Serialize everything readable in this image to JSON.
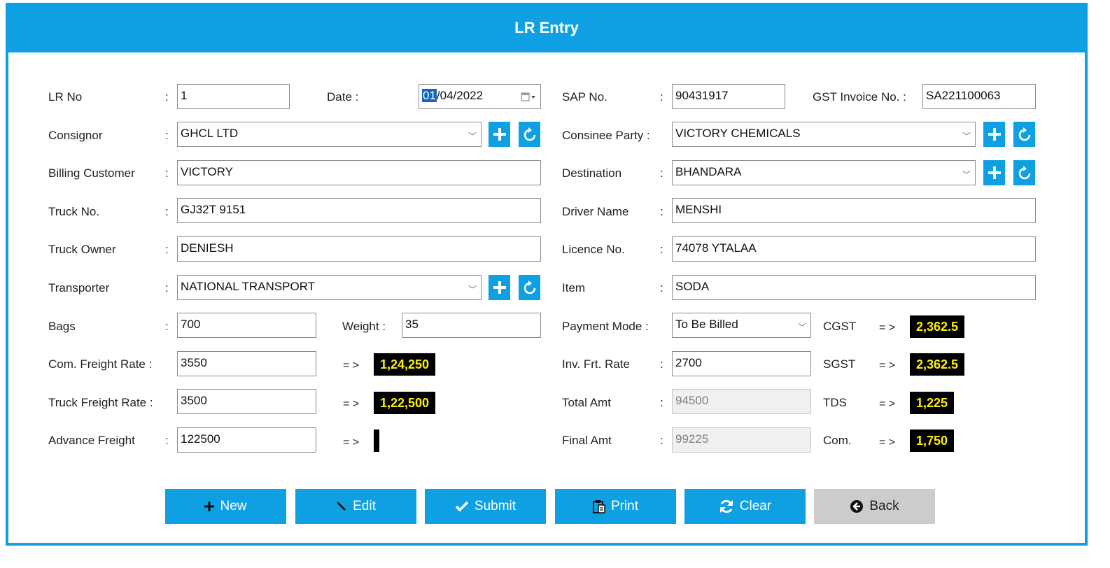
{
  "window": {
    "title": "LR Entry"
  },
  "form": {
    "lr_no": {
      "label": "LR No",
      "value": "1"
    },
    "date": {
      "label": "Date  :",
      "value_day": "01",
      "value_rest": "/04/2022"
    },
    "sap_no": {
      "label": "SAP No.",
      "value": "90431917"
    },
    "gst_invoice": {
      "label": "GST Invoice No. :",
      "value": "SA221100063"
    },
    "consignor": {
      "label": "Consignor",
      "value": "GHCL LTD"
    },
    "consignee": {
      "label": "Consinee Party :",
      "value": "VICTORY CHEMICALS"
    },
    "billing_customer": {
      "label": "Billing Customer",
      "value": "VICTORY"
    },
    "destination": {
      "label": "Destination",
      "value": "BHANDARA"
    },
    "truck_no": {
      "label": "Truck No.",
      "value": "GJ32T 9151"
    },
    "driver_name": {
      "label": "Driver Name",
      "value": "MENSHI"
    },
    "truck_owner": {
      "label": "Truck Owner",
      "value": "DENIESH"
    },
    "licence_no": {
      "label": "Licence No.",
      "value": "74078 YTALAA"
    },
    "transporter": {
      "label": "Transporter",
      "value": "NATIONAL TRANSPORT"
    },
    "item": {
      "label": "Item",
      "value": "SODA"
    },
    "bags": {
      "label": "Bags",
      "value": "700"
    },
    "weight": {
      "label": "Weight  :",
      "value": "35"
    },
    "payment_mode": {
      "label": "Payment Mode :",
      "value": "To Be Billed"
    },
    "com_freight_rate": {
      "label": "Com. Freight Rate  :",
      "value": "3550",
      "result": "1,24,250"
    },
    "inv_frt_rate": {
      "label": "Inv. Frt. Rate",
      "value": "2700"
    },
    "truck_freight_rate": {
      "label": "Truck Freight Rate :",
      "value": "3500",
      "result": "1,22,500"
    },
    "total_amt": {
      "label": "Total Amt",
      "value": "94500"
    },
    "advance_freight": {
      "label": "Advance Freight",
      "value": "122500",
      "result": ""
    },
    "final_amt": {
      "label": "Final Amt",
      "value": "99225"
    },
    "cgst": {
      "label": "CGST",
      "value": "2,362.5"
    },
    "sgst": {
      "label": "SGST",
      "value": "2,362.5"
    },
    "tds": {
      "label": "TDS",
      "value": "1,225"
    },
    "com": {
      "label": "Com.",
      "value": "1,750"
    },
    "colon": ":",
    "arrow": "= >"
  },
  "buttons": {
    "new": "New",
    "edit": "Edit",
    "submit": "Submit",
    "print": "Print",
    "clear": "Clear",
    "back": "Back"
  },
  "colors": {
    "accent": "#0fa0e3",
    "value_bg": "#000000",
    "value_fg": "#ffef00",
    "back_btn": "#cccccc"
  },
  "icons": [
    "plus-icon",
    "refresh-icon",
    "calendar-icon",
    "chevron-down-icon",
    "pencil-icon",
    "check-icon",
    "clipboard-icon",
    "sync-icon",
    "back-arrow-icon"
  ]
}
